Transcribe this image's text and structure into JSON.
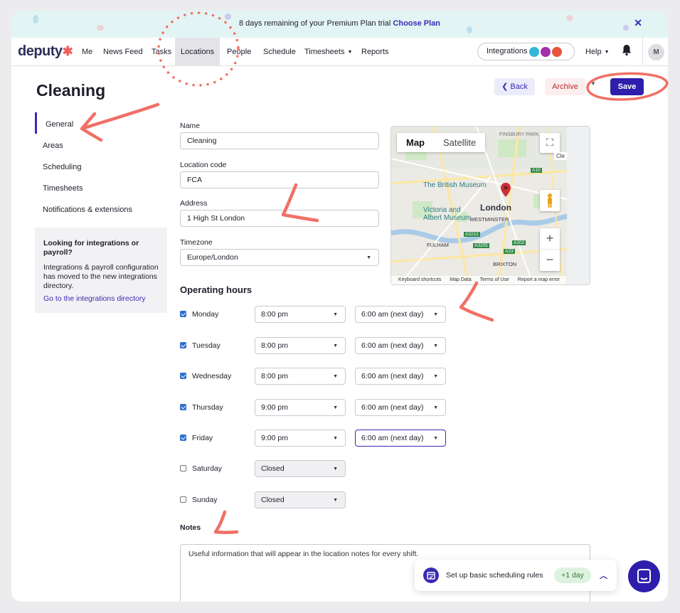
{
  "banner": {
    "text": "8 days remaining of your Premium Plan trial",
    "cta": "Choose Plan",
    "close": "✕"
  },
  "nav": {
    "logo": "deputy",
    "items": [
      "Me",
      "News Feed",
      "Tasks",
      "Locations",
      "People",
      "Schedule",
      "Timesheets",
      "Reports"
    ],
    "active": "Locations",
    "integrations": "Integrations",
    "help": "Help",
    "avatar": "M"
  },
  "page": {
    "title": "Cleaning",
    "back": "Back",
    "archive": "Archive",
    "save": "Save"
  },
  "sidebar": {
    "items": [
      "General",
      "Areas",
      "Scheduling",
      "Timesheets",
      "Notifications & extensions"
    ],
    "info_title": "Looking for integrations or payroll?",
    "info_body": "Integrations & payroll configuration has moved to the new integrations directory.",
    "info_link": "Go to the integrations directory"
  },
  "form": {
    "name_label": "Name",
    "name_value": "Cleaning",
    "code_label": "Location code",
    "code_value": "FCA",
    "address_label": "Address",
    "address_value": "1 High St London",
    "timezone_label": "Timezone",
    "timezone_value": "Europe/London"
  },
  "hours": {
    "title": "Operating hours",
    "days": [
      {
        "day": "Monday",
        "checked": true,
        "open": "8:00 pm",
        "close": "6:00 am (next day)"
      },
      {
        "day": "Tuesday",
        "checked": true,
        "open": "8:00 pm",
        "close": "6:00 am (next day)"
      },
      {
        "day": "Wednesday",
        "checked": true,
        "open": "8:00 pm",
        "close": "6:00 am (next day)"
      },
      {
        "day": "Thursday",
        "checked": true,
        "open": "9:00 pm",
        "close": "6:00 am (next day)"
      },
      {
        "day": "Friday",
        "checked": true,
        "open": "9:00 pm",
        "close": "6:00 am (next day)"
      },
      {
        "day": "Saturday",
        "checked": false,
        "open": "Closed",
        "close": ""
      },
      {
        "day": "Sunday",
        "checked": false,
        "open": "Closed",
        "close": ""
      }
    ]
  },
  "notes": {
    "label": "Notes",
    "value": "Useful information that will appear in the location notes for every shift."
  },
  "map": {
    "tab_map": "Map",
    "tab_satellite": "Satellite",
    "labels": [
      "FINSBURY PARK",
      "The British Museum",
      "London",
      "WESTMINSTER",
      "Victoria and Albert Museum",
      "FULHAM",
      "BRIXTON",
      "A10",
      "A3212",
      "A3205",
      "A202",
      "A23"
    ],
    "footer": [
      "Keyboard shortcuts",
      "Map Data",
      "Terms of Use",
      "Report a map error"
    ],
    "cut_label": "Cle"
  },
  "toast": {
    "text": "Set up basic scheduling rules",
    "badge": "+1 day"
  },
  "colors": {
    "primary": "#2d1eab",
    "annotation": "#f07066",
    "banner_bg": "#e3f4f4"
  }
}
